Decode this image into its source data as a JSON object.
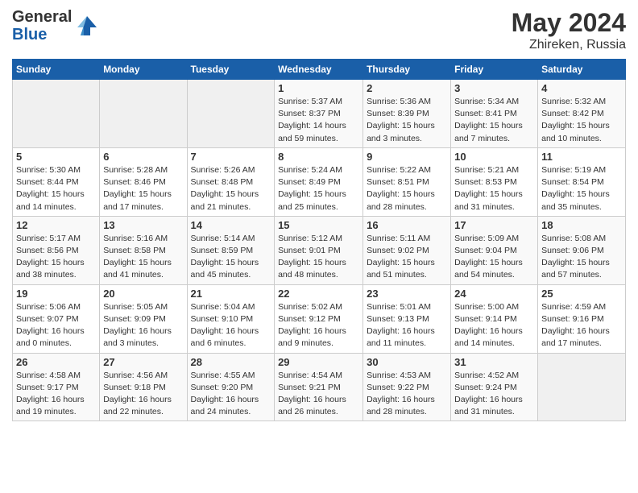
{
  "header": {
    "logo_line1": "General",
    "logo_line2": "Blue",
    "title": "May 2024",
    "subtitle": "Zhireken, Russia"
  },
  "days_of_week": [
    "Sunday",
    "Monday",
    "Tuesday",
    "Wednesday",
    "Thursday",
    "Friday",
    "Saturday"
  ],
  "weeks": [
    [
      {
        "num": "",
        "info": ""
      },
      {
        "num": "",
        "info": ""
      },
      {
        "num": "",
        "info": ""
      },
      {
        "num": "1",
        "info": "Sunrise: 5:37 AM\nSunset: 8:37 PM\nDaylight: 14 hours\nand 59 minutes."
      },
      {
        "num": "2",
        "info": "Sunrise: 5:36 AM\nSunset: 8:39 PM\nDaylight: 15 hours\nand 3 minutes."
      },
      {
        "num": "3",
        "info": "Sunrise: 5:34 AM\nSunset: 8:41 PM\nDaylight: 15 hours\nand 7 minutes."
      },
      {
        "num": "4",
        "info": "Sunrise: 5:32 AM\nSunset: 8:42 PM\nDaylight: 15 hours\nand 10 minutes."
      }
    ],
    [
      {
        "num": "5",
        "info": "Sunrise: 5:30 AM\nSunset: 8:44 PM\nDaylight: 15 hours\nand 14 minutes."
      },
      {
        "num": "6",
        "info": "Sunrise: 5:28 AM\nSunset: 8:46 PM\nDaylight: 15 hours\nand 17 minutes."
      },
      {
        "num": "7",
        "info": "Sunrise: 5:26 AM\nSunset: 8:48 PM\nDaylight: 15 hours\nand 21 minutes."
      },
      {
        "num": "8",
        "info": "Sunrise: 5:24 AM\nSunset: 8:49 PM\nDaylight: 15 hours\nand 25 minutes."
      },
      {
        "num": "9",
        "info": "Sunrise: 5:22 AM\nSunset: 8:51 PM\nDaylight: 15 hours\nand 28 minutes."
      },
      {
        "num": "10",
        "info": "Sunrise: 5:21 AM\nSunset: 8:53 PM\nDaylight: 15 hours\nand 31 minutes."
      },
      {
        "num": "11",
        "info": "Sunrise: 5:19 AM\nSunset: 8:54 PM\nDaylight: 15 hours\nand 35 minutes."
      }
    ],
    [
      {
        "num": "12",
        "info": "Sunrise: 5:17 AM\nSunset: 8:56 PM\nDaylight: 15 hours\nand 38 minutes."
      },
      {
        "num": "13",
        "info": "Sunrise: 5:16 AM\nSunset: 8:58 PM\nDaylight: 15 hours\nand 41 minutes."
      },
      {
        "num": "14",
        "info": "Sunrise: 5:14 AM\nSunset: 8:59 PM\nDaylight: 15 hours\nand 45 minutes."
      },
      {
        "num": "15",
        "info": "Sunrise: 5:12 AM\nSunset: 9:01 PM\nDaylight: 15 hours\nand 48 minutes."
      },
      {
        "num": "16",
        "info": "Sunrise: 5:11 AM\nSunset: 9:02 PM\nDaylight: 15 hours\nand 51 minutes."
      },
      {
        "num": "17",
        "info": "Sunrise: 5:09 AM\nSunset: 9:04 PM\nDaylight: 15 hours\nand 54 minutes."
      },
      {
        "num": "18",
        "info": "Sunrise: 5:08 AM\nSunset: 9:06 PM\nDaylight: 15 hours\nand 57 minutes."
      }
    ],
    [
      {
        "num": "19",
        "info": "Sunrise: 5:06 AM\nSunset: 9:07 PM\nDaylight: 16 hours\nand 0 minutes."
      },
      {
        "num": "20",
        "info": "Sunrise: 5:05 AM\nSunset: 9:09 PM\nDaylight: 16 hours\nand 3 minutes."
      },
      {
        "num": "21",
        "info": "Sunrise: 5:04 AM\nSunset: 9:10 PM\nDaylight: 16 hours\nand 6 minutes."
      },
      {
        "num": "22",
        "info": "Sunrise: 5:02 AM\nSunset: 9:12 PM\nDaylight: 16 hours\nand 9 minutes."
      },
      {
        "num": "23",
        "info": "Sunrise: 5:01 AM\nSunset: 9:13 PM\nDaylight: 16 hours\nand 11 minutes."
      },
      {
        "num": "24",
        "info": "Sunrise: 5:00 AM\nSunset: 9:14 PM\nDaylight: 16 hours\nand 14 minutes."
      },
      {
        "num": "25",
        "info": "Sunrise: 4:59 AM\nSunset: 9:16 PM\nDaylight: 16 hours\nand 17 minutes."
      }
    ],
    [
      {
        "num": "26",
        "info": "Sunrise: 4:58 AM\nSunset: 9:17 PM\nDaylight: 16 hours\nand 19 minutes."
      },
      {
        "num": "27",
        "info": "Sunrise: 4:56 AM\nSunset: 9:18 PM\nDaylight: 16 hours\nand 22 minutes."
      },
      {
        "num": "28",
        "info": "Sunrise: 4:55 AM\nSunset: 9:20 PM\nDaylight: 16 hours\nand 24 minutes."
      },
      {
        "num": "29",
        "info": "Sunrise: 4:54 AM\nSunset: 9:21 PM\nDaylight: 16 hours\nand 26 minutes."
      },
      {
        "num": "30",
        "info": "Sunrise: 4:53 AM\nSunset: 9:22 PM\nDaylight: 16 hours\nand 28 minutes."
      },
      {
        "num": "31",
        "info": "Sunrise: 4:52 AM\nSunset: 9:24 PM\nDaylight: 16 hours\nand 31 minutes."
      },
      {
        "num": "",
        "info": ""
      }
    ]
  ]
}
